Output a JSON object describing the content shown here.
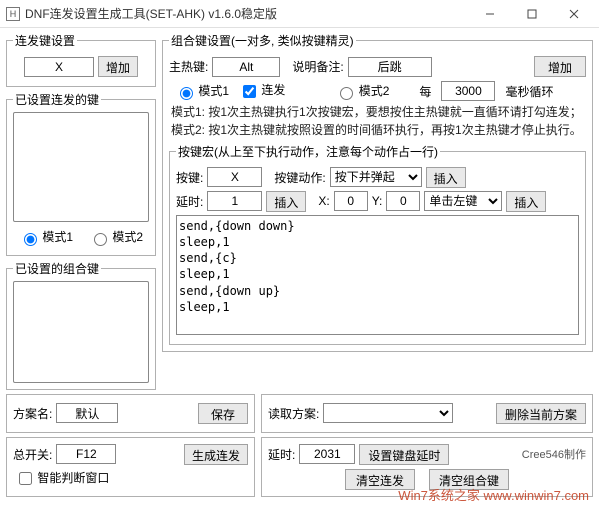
{
  "titlebar": {
    "icon_letter": "H",
    "title": "DNF连发设置生成工具(SET-AHK) v1.6.0稳定版"
  },
  "left": {
    "repeat_group_title": "连发键设置",
    "repeat_key_value": "X",
    "add_label": "增加",
    "set_repeat_group_title": "已设置连发的键",
    "mode1_label": "模式1",
    "mode2_label": "模式2",
    "combo_set_group_title": "已设置的组合键"
  },
  "combo": {
    "group_title": "组合键设置(一对多, 类似按键精灵)",
    "main_hotkey_label": "主热键:",
    "main_hotkey_value": "Alt",
    "desc_label": "说明备注:",
    "desc_value": "后跳",
    "add_label": "增加",
    "mode1_label": "模式1",
    "repeat_check_label": "连发",
    "mode2_label": "模式2",
    "every_label": "每",
    "every_value": "3000",
    "every_unit": "毫秒循环",
    "info_line1": "模式1: 按1次主热键执行1次按键宏，要想按住主热键就一直循环请打勾连发；",
    "info_line2": "模式2: 按1次主热键就按照设置的时间循环执行，再按1次主热键才停止执行。",
    "macro_title": "按键宏(从上至下执行动作，注意每个动作占一行)",
    "key_label": "按键:",
    "key_value": "X",
    "action_label": "按键动作:",
    "action_value": "按下并弹起",
    "insert_label": "插入",
    "delay_label": "延时:",
    "delay_value": "1",
    "x_label": "X:",
    "x_value": "0",
    "y_label": "Y:",
    "y_value": "0",
    "click_value": "单击左键",
    "macro_text": "send,{down down}\nsleep,1\nsend,{c}\nsleep,1\nsend,{down up}\nsleep,1"
  },
  "plan": {
    "name_label": "方案名:",
    "name_value": "默认",
    "save_label": "保存",
    "read_label": "读取方案:",
    "delete_label": "删除当前方案"
  },
  "bottom": {
    "main_switch_label": "总开关:",
    "main_switch_value": "F12",
    "gen_label": "生成连发",
    "smart_check_label": "智能判断窗口",
    "delay_label": "延时:",
    "delay_value": "2031",
    "set_kbd_delay_label": "设置键盘延时",
    "clear_repeat_label": "清空连发",
    "clear_combo_label": "清空组合键",
    "credit": "Cree546制作"
  },
  "watermark": "Win7系统之家   www.winwin7.com"
}
